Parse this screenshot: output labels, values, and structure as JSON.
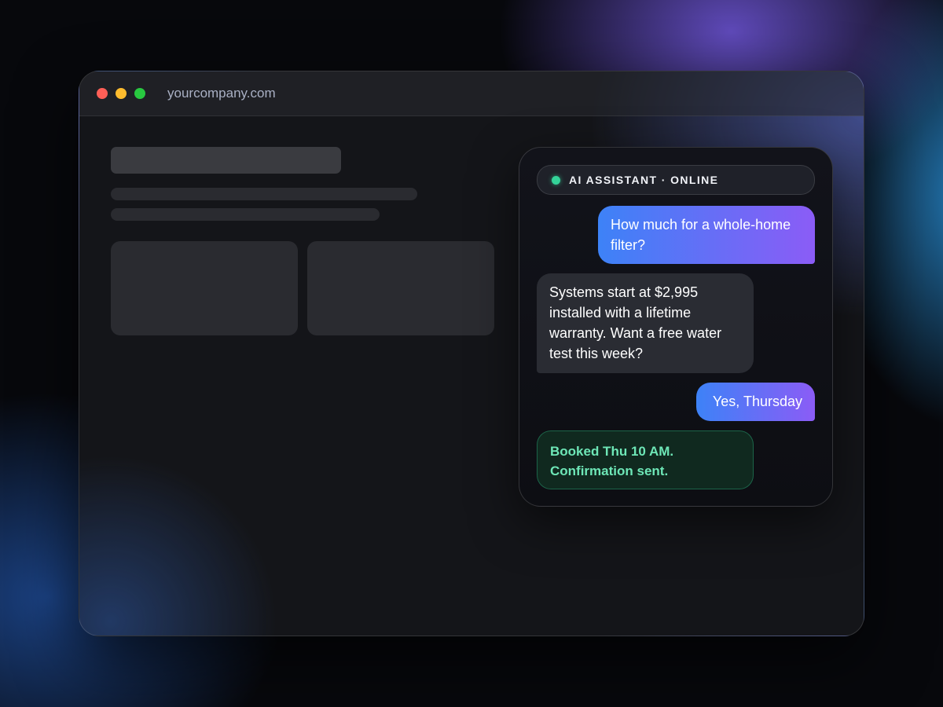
{
  "browser": {
    "url": "yourcompany.com",
    "traffic_lights": [
      "close",
      "minimize",
      "maximize"
    ]
  },
  "chat": {
    "status": "AI ASSISTANT · ONLINE",
    "status_color": "#34d399",
    "messages": [
      {
        "from": "user",
        "text": "How much for a whole-home filter?"
      },
      {
        "from": "assistant",
        "text": "Systems start at $2,995 installed with a lifetime warranty. Want a free water test this week?"
      },
      {
        "from": "user",
        "text": "Yes, Thursday"
      },
      {
        "from": "assistant",
        "type": "confirmation",
        "text": "Booked Thu 10 AM. Confirmation sent."
      }
    ]
  },
  "colors": {
    "user_bubble_start": "#3d82f7",
    "user_bubble_end": "#8b5cf6",
    "assistant_bubble": "#2a2c33",
    "confirmation_text": "#6ee7b7"
  }
}
